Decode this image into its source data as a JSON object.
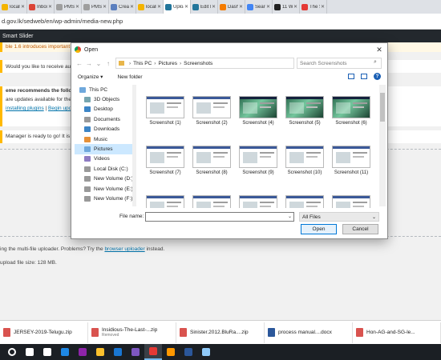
{
  "browser": {
    "tabs": [
      {
        "label": "localh",
        "icon_color": "#f4b400",
        "active": false
      },
      {
        "label": "Inbox",
        "icon_color": "#db4437",
        "active": false
      },
      {
        "label": "PMS",
        "icon_color": "#9e9e9e",
        "active": false
      },
      {
        "label": "PMS",
        "icon_color": "#9e9e9e",
        "active": false
      },
      {
        "label": "Creat",
        "icon_color": "#5b7fbf",
        "active": false
      },
      {
        "label": "localh",
        "icon_color": "#f4b400",
        "active": false
      },
      {
        "label": "Uploa",
        "icon_color": "#21759b",
        "active": true
      },
      {
        "label": "Edit M",
        "icon_color": "#21759b",
        "active": false
      },
      {
        "label": "Dashb",
        "icon_color": "#f57c00",
        "active": false
      },
      {
        "label": "Searc",
        "icon_color": "#4285f4",
        "active": false
      },
      {
        "label": "11 W",
        "icon_color": "#222222",
        "active": false
      },
      {
        "label": "The S",
        "icon_color": "#e53935",
        "active": false
      }
    ],
    "address": "d.gov.lk/sedweb/en/wp-admin/media-new.php"
  },
  "wp": {
    "admin_bar_item": "Smart Slider",
    "notice_update": "ble 1.6 introduces important",
    "notice_question": "Would you like to receive auto",
    "notice_theme_line1": "eme recommends the follow",
    "notice_theme_line2": "are updates available for the",
    "notice_link1": "installing plugins",
    "notice_link_sep": " | ",
    "notice_link2": "Begin upd",
    "notice_manager": "Manager is ready to go! It is h",
    "uploader_msg_prefix": "ing the multi-file uploader. Problems? Try the ",
    "uploader_msg_link": "browser uploader",
    "uploader_msg_suffix": " instead.",
    "max_size": "upload file size: 128 MB."
  },
  "dialog": {
    "title": "Open",
    "breadcrumb": [
      "This PC",
      "Pictures",
      "Screenshots"
    ],
    "search_placeholder": "Search Screenshots",
    "organize_label": "Organize ▾",
    "new_folder_label": "New folder",
    "nav_items": [
      {
        "label": "This PC",
        "icon_color": "#6fa8dc",
        "selected": false,
        "sub": false
      },
      {
        "label": "3D Objects",
        "icon_color": "#76a5af",
        "selected": false,
        "sub": true
      },
      {
        "label": "Desktop",
        "icon_color": "#3d85c6",
        "selected": false,
        "sub": true
      },
      {
        "label": "Documents",
        "icon_color": "#999999",
        "selected": false,
        "sub": true
      },
      {
        "label": "Downloads",
        "icon_color": "#3d85c6",
        "selected": false,
        "sub": true
      },
      {
        "label": "Music",
        "icon_color": "#e69138",
        "selected": false,
        "sub": true
      },
      {
        "label": "Pictures",
        "icon_color": "#6fa8dc",
        "selected": true,
        "sub": true
      },
      {
        "label": "Videos",
        "icon_color": "#8e7cc3",
        "selected": false,
        "sub": true
      },
      {
        "label": "Local Disk (C:)",
        "icon_color": "#999999",
        "selected": false,
        "sub": true
      },
      {
        "label": "New Volume (D:)",
        "icon_color": "#999999",
        "selected": false,
        "sub": true
      },
      {
        "label": "New Volume (E:)",
        "icon_color": "#999999",
        "selected": false,
        "sub": true
      },
      {
        "label": "New Volume (F:)",
        "icon_color": "#999999",
        "selected": false,
        "sub": true
      }
    ],
    "files": [
      {
        "name": "Screenshot (1)",
        "style": "page"
      },
      {
        "name": "Screenshot (2)",
        "style": "page"
      },
      {
        "name": "Screenshot (4)",
        "style": "photo"
      },
      {
        "name": "Screenshot (5)",
        "style": "photo"
      },
      {
        "name": "Screenshot (6)",
        "style": "photo"
      },
      {
        "name": "Screenshot (7)",
        "style": "page"
      },
      {
        "name": "Screenshot (8)",
        "style": "page"
      },
      {
        "name": "Screenshot (9)",
        "style": "page"
      },
      {
        "name": "Screenshot (10)",
        "style": "page"
      },
      {
        "name": "Screenshot (11)",
        "style": "page"
      },
      {
        "name": "",
        "style": "page"
      },
      {
        "name": "",
        "style": "page"
      },
      {
        "name": "",
        "style": "page"
      },
      {
        "name": "",
        "style": "page"
      },
      {
        "name": "",
        "style": "page"
      }
    ],
    "filename_label": "File name:",
    "filename_value": "",
    "filetype": "All Files",
    "open_label": "Open",
    "cancel_label": "Cancel"
  },
  "downloads": [
    {
      "name": "JERSEY-2019-Telugu.zip",
      "sub": "",
      "icon": "zip"
    },
    {
      "name": "Insidious-The-Last-...zip",
      "sub": "Removed",
      "icon": "zip"
    },
    {
      "name": "Sinister.2012.BluRa....zip",
      "sub": "",
      "icon": "zip"
    },
    {
      "name": "process manual....docx",
      "sub": "",
      "icon": "doc"
    },
    {
      "name": "Hon-AG-and-SG-le...",
      "sub": "",
      "icon": "zip"
    }
  ],
  "taskbar": [
    {
      "name": "start-icon",
      "color": "#ffffff",
      "active": false
    },
    {
      "name": "search-icon",
      "color": "#ffffff",
      "active": false
    },
    {
      "name": "task-view-icon",
      "color": "#ffffff",
      "active": false
    },
    {
      "name": "app-icon",
      "color": "#1e88e5",
      "active": false
    },
    {
      "name": "paint-icon",
      "color": "#8e24aa",
      "active": false
    },
    {
      "name": "explorer-icon",
      "color": "#fbc02d",
      "active": false
    },
    {
      "name": "email-icon",
      "color": "#1976d2",
      "active": false
    },
    {
      "name": "visual-studio-icon",
      "color": "#7e57c2",
      "active": false
    },
    {
      "name": "chrome-icon",
      "color": "#e53935",
      "active": true
    },
    {
      "name": "vlc-icon",
      "color": "#ff9800",
      "active": false
    },
    {
      "name": "word-icon",
      "color": "#2b579a",
      "active": false
    },
    {
      "name": "file-icon",
      "color": "#90caf9",
      "active": false
    }
  ]
}
